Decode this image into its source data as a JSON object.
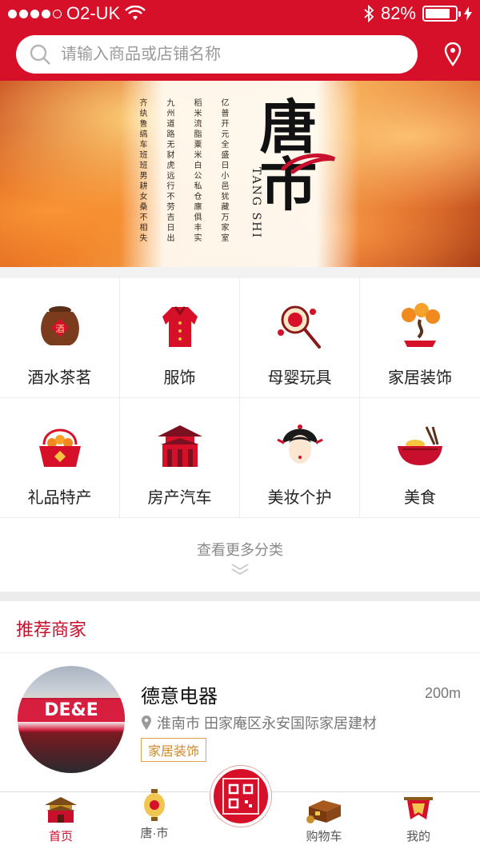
{
  "status_bar": {
    "carrier": "O2-UK",
    "battery_percent": "82%",
    "battery_level": 0.82
  },
  "search": {
    "placeholder": "请输入商品或店铺名称",
    "icon": "search-icon"
  },
  "location": {
    "icon": "location-pin-icon"
  },
  "banner": {
    "brand_cn": "唐市",
    "brand_en": "TANG SHI",
    "poem_columns": [
      "亿普开元全盛日小邑犹藏万家室",
      "稻米流脂粟米白公私仓廪俱丰实",
      "九州道路无豺虎远行不劳吉日出",
      "齐纨鲁缟车班班男耕女桑不相失"
    ]
  },
  "categories": [
    {
      "label": "酒水茶茗",
      "icon": "wine-jar-icon"
    },
    {
      "label": "服饰",
      "icon": "garment-icon"
    },
    {
      "label": "母婴玩具",
      "icon": "rattle-drum-icon"
    },
    {
      "label": "家居装饰",
      "icon": "bonsai-icon"
    },
    {
      "label": "礼品特产",
      "icon": "gift-basket-icon"
    },
    {
      "label": "房产汽车",
      "icon": "pavilion-icon"
    },
    {
      "label": "美妆个护",
      "icon": "tang-lady-icon"
    },
    {
      "label": "美食",
      "icon": "noodle-bowl-icon"
    }
  ],
  "more_categories": {
    "label": "查看更多分类",
    "icon": "double-chevron-down-icon"
  },
  "recommended": {
    "title": "推荐商家",
    "merchant": {
      "name": "德意电器",
      "distance": "200m",
      "address": "淮南市 田家庵区永安国际家居建材",
      "tag": "家居装饰",
      "sign_text": "DE&E"
    }
  },
  "tabbar": {
    "tabs": [
      {
        "label": "首页",
        "icon": "palace-icon",
        "active": true
      },
      {
        "label": "唐·市",
        "icon": "lantern-icon",
        "active": false
      },
      {
        "label": "购物车",
        "icon": "treasure-chest-icon",
        "active": false
      },
      {
        "label": "我的",
        "icon": "banner-flag-icon",
        "active": false
      }
    ],
    "scan_icon": "qr-scan-icon"
  },
  "colors": {
    "brand_red": "#d7102a",
    "section_title": "#c8102e",
    "tag_orange": "#d08a2a"
  }
}
